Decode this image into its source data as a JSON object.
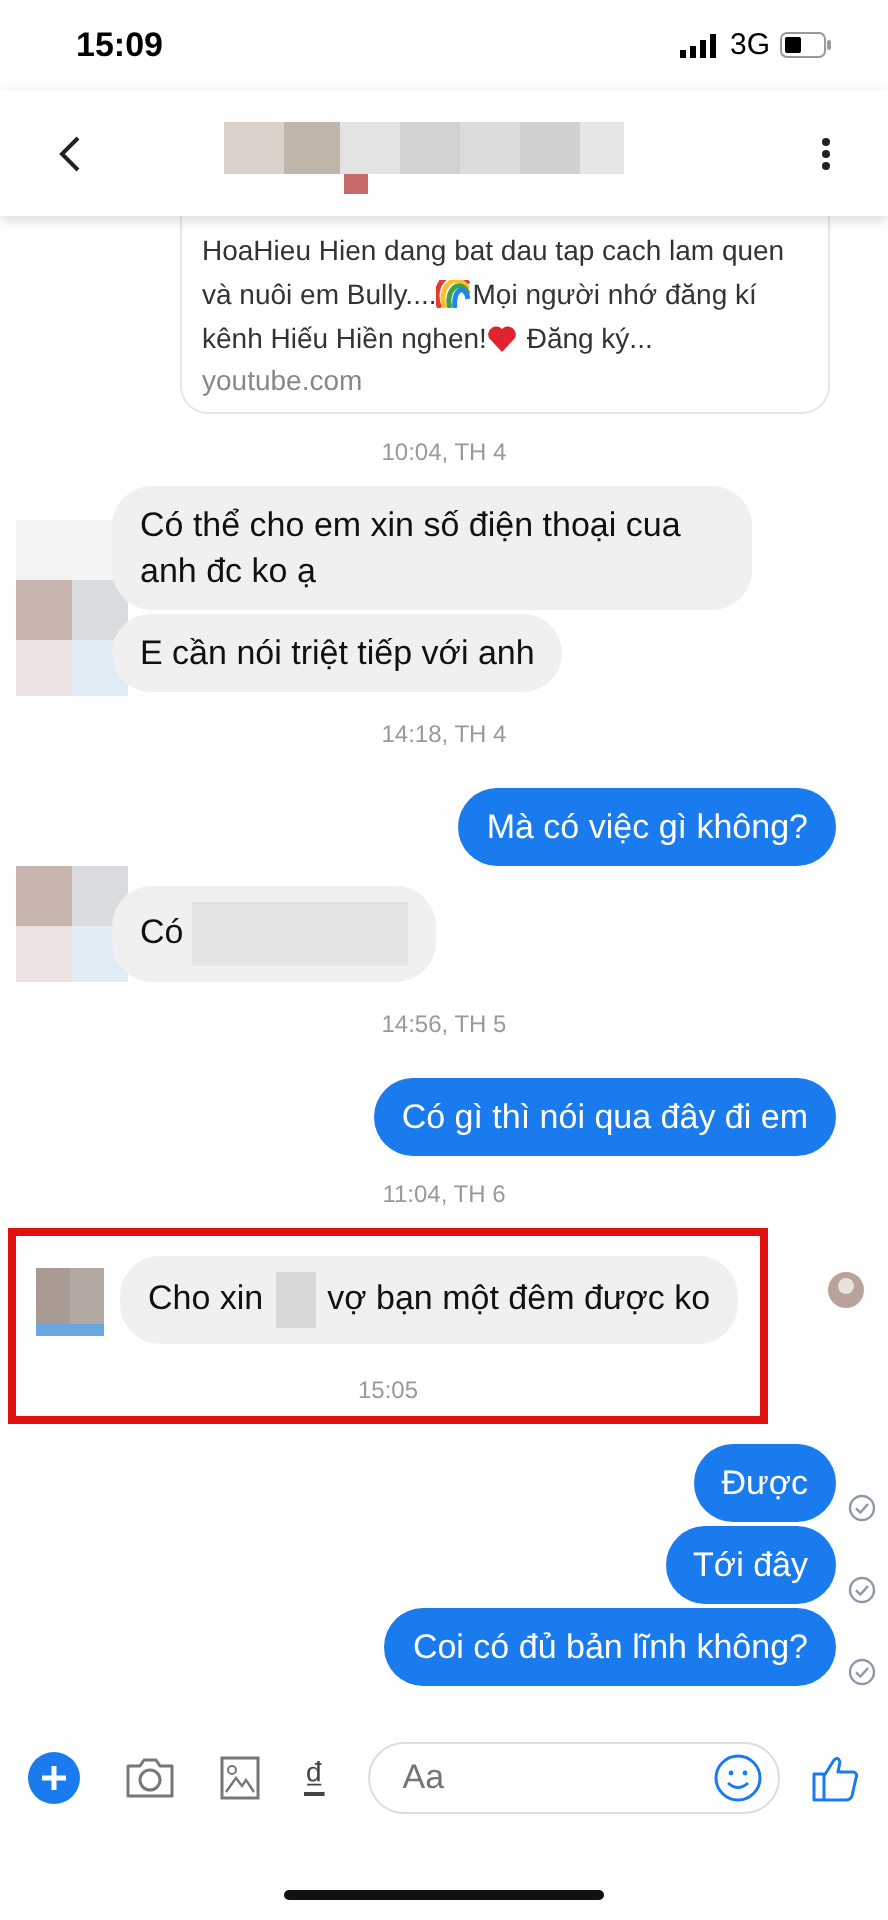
{
  "status_bar": {
    "time": "15:09",
    "network": "3G"
  },
  "link_preview": {
    "segments": [
      {
        "kind": "text",
        "text": "HoaHieu Hien dang bat dau tap cach lam quen và nuôi em Bully...."
      },
      {
        "kind": "rainbow"
      },
      {
        "kind": "text",
        "text": "Mọi người nhớ đăng kí kênh Hiếu Hiền nghen!"
      },
      {
        "kind": "heart"
      },
      {
        "kind": "text",
        "text": " Đăng ký..."
      }
    ],
    "domain": "youtube.com"
  },
  "items": [
    {
      "kind": "time",
      "text": "10:04, TH 4"
    },
    {
      "kind": "incoming_group",
      "messages": [
        {
          "parts": [
            {
              "kind": "text",
              "text": "Có thể cho em xin số điện thoại cua anh đc ko ạ"
            }
          ]
        },
        {
          "parts": [
            {
              "kind": "text",
              "text": "E cần nói triệt tiếp với anh"
            }
          ]
        }
      ]
    },
    {
      "kind": "time",
      "text": "14:18, TH 4"
    },
    {
      "kind": "outgoing_group",
      "messages": [
        {
          "parts": [
            {
              "kind": "text",
              "text": "Mà có việc gì không?"
            }
          ],
          "delivered": false
        }
      ]
    },
    {
      "kind": "incoming_group",
      "messages": [
        {
          "parts": [
            {
              "kind": "text",
              "text": "Có"
            },
            {
              "kind": "redacted"
            }
          ]
        }
      ]
    },
    {
      "kind": "time",
      "text": "14:56, TH 5"
    },
    {
      "kind": "outgoing_group",
      "messages": [
        {
          "parts": [
            {
              "kind": "text",
              "text": "Có gì thì nói qua đây đi em"
            }
          ],
          "delivered": false
        }
      ]
    },
    {
      "kind": "time",
      "text": "11:04, TH 6"
    },
    {
      "kind": "highlight_box",
      "items": [
        {
          "kind": "incoming_group",
          "seen": true,
          "messages": [
            {
              "parts": [
                {
                  "kind": "text",
                  "text": "Cho xin"
                },
                {
                  "kind": "redacted"
                },
                {
                  "kind": "text",
                  "text": "vợ bạn một đêm được ko"
                }
              ]
            }
          ]
        },
        {
          "kind": "time",
          "text": "15:05"
        }
      ]
    },
    {
      "kind": "outgoing_group",
      "messages": [
        {
          "parts": [
            {
              "kind": "text",
              "text": "Được"
            }
          ],
          "delivered": true
        },
        {
          "parts": [
            {
              "kind": "text",
              "text": "Tới đây"
            }
          ],
          "delivered": true
        },
        {
          "parts": [
            {
              "kind": "text",
              "text": "Coi có đủ bản lĩnh không?"
            }
          ],
          "delivered": true
        }
      ]
    }
  ],
  "composer": {
    "currency": "₫",
    "placeholder": "Aa"
  }
}
